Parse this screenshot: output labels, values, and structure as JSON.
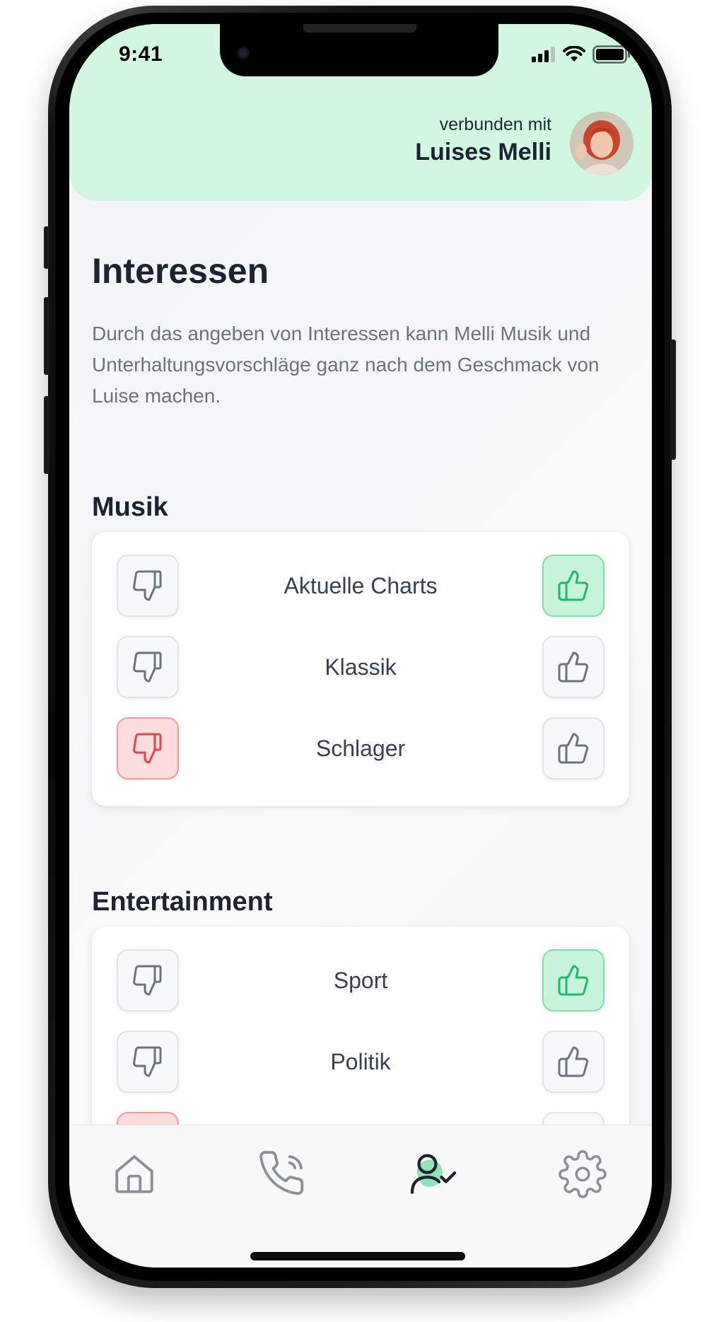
{
  "status_bar": {
    "time": "9:41"
  },
  "header": {
    "connected_label": "verbunden mit",
    "connected_name": "Luises Melli"
  },
  "page": {
    "title": "Interessen",
    "description": "Durch das angeben von Interessen kann Melli Musik und Unterhaltungsvorschläge ganz nach dem Geschmack von Luise machen."
  },
  "sections": [
    {
      "title": "Musik",
      "items": [
        {
          "label": "Aktuelle Charts",
          "vote": "up"
        },
        {
          "label": "Klassik",
          "vote": "none"
        },
        {
          "label": "Schlager",
          "vote": "down"
        }
      ]
    },
    {
      "title": "Entertainment",
      "items": [
        {
          "label": "Sport",
          "vote": "up"
        },
        {
          "label": "Politik",
          "vote": "none"
        },
        {
          "label": "",
          "vote": "down"
        }
      ]
    }
  ],
  "nav": {
    "items": [
      {
        "icon": "home-icon",
        "active": false
      },
      {
        "icon": "phone-call-icon",
        "active": false
      },
      {
        "icon": "user-check-icon",
        "active": true
      },
      {
        "icon": "gear-icon",
        "active": false
      }
    ]
  },
  "colors": {
    "header_bg": "#d1f7e1",
    "accent_green": "#22b86b",
    "active_up_bg": "#c6f3da",
    "active_down_bg": "#fcdcdc",
    "dislike_red": "#e0474c",
    "text_dark": "#1c2433",
    "text_muted": "#6b7280"
  }
}
